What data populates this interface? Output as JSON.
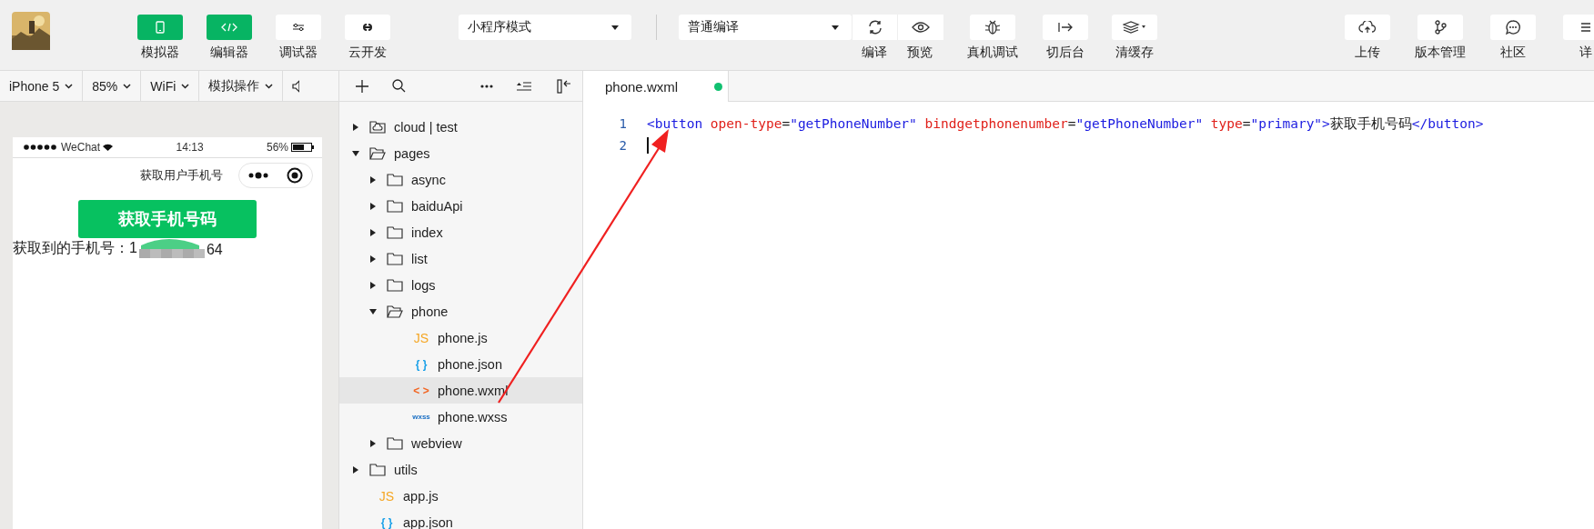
{
  "toolbar": {
    "modes": [
      {
        "label": "模拟器",
        "kind": "simulator",
        "selected": true
      },
      {
        "label": "编辑器",
        "kind": "editor",
        "selected": true
      },
      {
        "label": "调试器",
        "kind": "debugger",
        "selected": false
      },
      {
        "label": "云开发",
        "kind": "cloud",
        "selected": false
      }
    ],
    "mode_select": {
      "value": "小程序模式"
    },
    "compile_select": {
      "value": "普通编译"
    },
    "actions": [
      {
        "label": "编译",
        "kind": "refresh"
      },
      {
        "label": "预览",
        "kind": "eye"
      },
      {
        "label": "真机调试",
        "kind": "bug"
      },
      {
        "label": "切后台",
        "kind": "switch"
      },
      {
        "label": "清缓存",
        "kind": "layers"
      }
    ],
    "right_actions": [
      {
        "label": "上传",
        "kind": "upload"
      },
      {
        "label": "版本管理",
        "kind": "branch"
      },
      {
        "label": "社区",
        "kind": "chat"
      },
      {
        "label": "详",
        "kind": "menu"
      }
    ]
  },
  "simulator": {
    "controls": [
      {
        "label": "iPhone 5"
      },
      {
        "label": "85%"
      },
      {
        "label": "WiFi"
      },
      {
        "label": "模拟操作"
      }
    ],
    "status_bar": {
      "carrier": "WeChat",
      "time": "14:13",
      "battery": "56%"
    },
    "nav_title": "获取用户手机号",
    "button": "获取手机号码",
    "result_label": "获取到的手机号：1",
    "result_tail": "64"
  },
  "tree": [
    {
      "name": "cloud | test",
      "kind": "cloud",
      "expanded": false,
      "selected": false
    },
    {
      "name": "pages",
      "kind": "folder",
      "expanded": true,
      "selected": false,
      "children": [
        {
          "name": "async",
          "kind": "folder",
          "expanded": false,
          "selected": false
        },
        {
          "name": "baiduApi",
          "kind": "folder",
          "expanded": false,
          "selected": false
        },
        {
          "name": "index",
          "kind": "folder",
          "expanded": false,
          "selected": false
        },
        {
          "name": "list",
          "kind": "folder",
          "expanded": false,
          "selected": false
        },
        {
          "name": "logs",
          "kind": "folder",
          "expanded": false,
          "selected": false
        },
        {
          "name": "phone",
          "kind": "folder",
          "expanded": true,
          "selected": false,
          "children": [
            {
              "name": "phone.js",
              "kind": "js",
              "icon": "JS",
              "selected": false
            },
            {
              "name": "phone.json",
              "kind": "json",
              "icon": "{ }",
              "selected": false
            },
            {
              "name": "phone.wxml",
              "kind": "wxml",
              "icon": "< >",
              "selected": true
            },
            {
              "name": "phone.wxss",
              "kind": "wxss",
              "icon": "wxss",
              "selected": false
            }
          ]
        },
        {
          "name": "webview",
          "kind": "folder",
          "expanded": false,
          "selected": false
        }
      ]
    },
    {
      "name": "utils",
      "kind": "folder",
      "expanded": false,
      "selected": false
    },
    {
      "name": "app.js",
      "kind": "js",
      "icon": "JS",
      "selected": false
    },
    {
      "name": "app.json",
      "kind": "json",
      "icon": "{ }",
      "selected": false
    }
  ],
  "editor": {
    "tabs": [
      {
        "label": "phone.wxml",
        "modified": true,
        "selected": true
      }
    ],
    "lines": [
      {
        "number": "1",
        "tokens": [
          {
            "kind": "tag",
            "text": "<button"
          },
          {
            "kind": "attr",
            "text": " open-type"
          },
          {
            "kind": "punct",
            "text": "="
          },
          {
            "kind": "string",
            "text": "\"getPhoneNumber\""
          },
          {
            "kind": "attr",
            "text": " bindgetphonenumber"
          },
          {
            "kind": "punct",
            "text": "="
          },
          {
            "kind": "string",
            "text": "\"getPhoneNumber\""
          },
          {
            "kind": "attr",
            "text": " type"
          },
          {
            "kind": "punct",
            "text": "="
          },
          {
            "kind": "string",
            "text": "\"primary\""
          },
          {
            "kind": "tag",
            "text": ">"
          },
          {
            "kind": "text",
            "text": "获取手机号码"
          },
          {
            "kind": "tag",
            "text": "</button>"
          }
        ]
      },
      {
        "number": "2",
        "cursor": true
      }
    ]
  }
}
